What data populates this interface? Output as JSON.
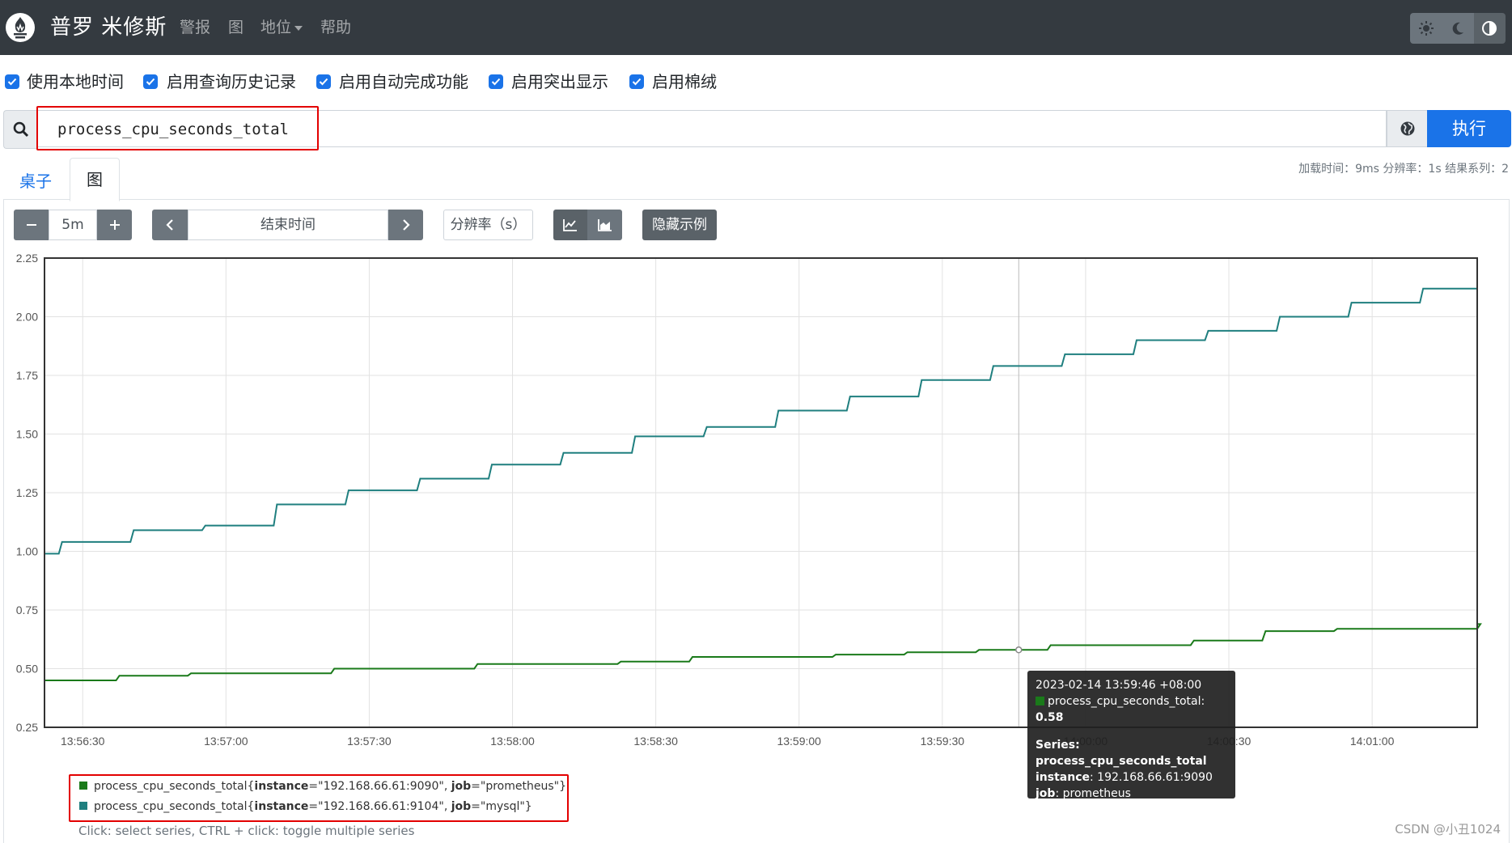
{
  "navbar": {
    "brand": "普罗 米修斯",
    "links": [
      "警报",
      "图",
      "地位",
      "帮助"
    ]
  },
  "settings": [
    "使用本地时间",
    "启用查询历史记录",
    "启用自动完成功能",
    "启用突出显示",
    "启用棉绒"
  ],
  "query": {
    "expression": "process_cpu_seconds_total",
    "execute_label": "执行"
  },
  "tabs": {
    "table": "桌子",
    "graph": "图"
  },
  "stats": "加载时间：9ms 分辨率：1s 结果系列：2",
  "controls": {
    "range": "5m",
    "end_time_placeholder": "结束时间",
    "resolution_placeholder": "分辨率（s）",
    "hide_exemplars": "隐藏示例"
  },
  "tooltip": {
    "time": "2023-02-14 13:59:46 +08:00",
    "metric": "process_cpu_seconds_total",
    "value": "0.58",
    "series_label": "Series:",
    "series_name": "process_cpu_seconds_total",
    "instance_key": "instance",
    "instance_value": "192.168.66.61:9090",
    "job_key": "job",
    "job_value": "prometheus"
  },
  "legend": {
    "series": [
      {
        "metric": "process_cpu_seconds_total",
        "instance": "\"192.168.66.61:9090\"",
        "job": "\"prometheus\"",
        "color": "#1a7a1a"
      },
      {
        "metric": "process_cpu_seconds_total",
        "instance": "\"192.168.66.61:9104\"",
        "job": "\"mysql\"",
        "color": "#1f7f7f"
      }
    ],
    "hint": "Click: select series, CTRL + click: toggle multiple series"
  },
  "watermark": "CSDN @小丑1024",
  "chart_data": {
    "type": "line",
    "ylim": [
      0.25,
      2.25
    ],
    "yticks": [
      "0.25",
      "0.50",
      "0.75",
      "1.00",
      "1.25",
      "1.50",
      "1.75",
      "2.00",
      "2.25"
    ],
    "xticks": [
      "13:56:30",
      "13:57:00",
      "13:57:30",
      "13:58:00",
      "13:58:30",
      "13:59:00",
      "13:59:30",
      "14:00:00",
      "14:00:30",
      "14:01:00"
    ],
    "x_range_seconds": [
      "13:56:22",
      "14:01:22"
    ],
    "grid": true,
    "series": [
      {
        "color": "#1f7f7f",
        "steps": [
          [
            "13:56:22",
            0.99
          ],
          [
            "13:56:25",
            1.04
          ],
          [
            "13:56:40",
            1.09
          ],
          [
            "13:56:55",
            1.11
          ],
          [
            "13:57:10",
            1.2
          ],
          [
            "13:57:25",
            1.26
          ],
          [
            "13:57:40",
            1.31
          ],
          [
            "13:57:55",
            1.37
          ],
          [
            "13:58:10",
            1.42
          ],
          [
            "13:58:25",
            1.49
          ],
          [
            "13:58:40",
            1.53
          ],
          [
            "13:58:55",
            1.6
          ],
          [
            "13:59:10",
            1.66
          ],
          [
            "13:59:25",
            1.73
          ],
          [
            "13:59:40",
            1.79
          ],
          [
            "13:59:55",
            1.84
          ],
          [
            "14:00:10",
            1.9
          ],
          [
            "14:00:25",
            1.94
          ],
          [
            "14:00:40",
            2.0
          ],
          [
            "14:00:55",
            2.06
          ],
          [
            "14:01:10",
            2.12
          ]
        ]
      },
      {
        "color": "#1a7a1a",
        "steps": [
          [
            "13:56:22",
            0.45
          ],
          [
            "13:56:37",
            0.47
          ],
          [
            "13:56:52",
            0.48
          ],
          [
            "13:57:22",
            0.5
          ],
          [
            "13:57:52",
            0.52
          ],
          [
            "13:58:22",
            0.53
          ],
          [
            "13:58:37",
            0.55
          ],
          [
            "13:59:07",
            0.56
          ],
          [
            "13:59:22",
            0.57
          ],
          [
            "13:59:37",
            0.58
          ],
          [
            "13:59:52",
            0.6
          ],
          [
            "14:00:22",
            0.62
          ],
          [
            "14:00:37",
            0.66
          ],
          [
            "14:00:52",
            0.67
          ],
          [
            "14:01:22",
            0.69
          ]
        ]
      }
    ]
  }
}
